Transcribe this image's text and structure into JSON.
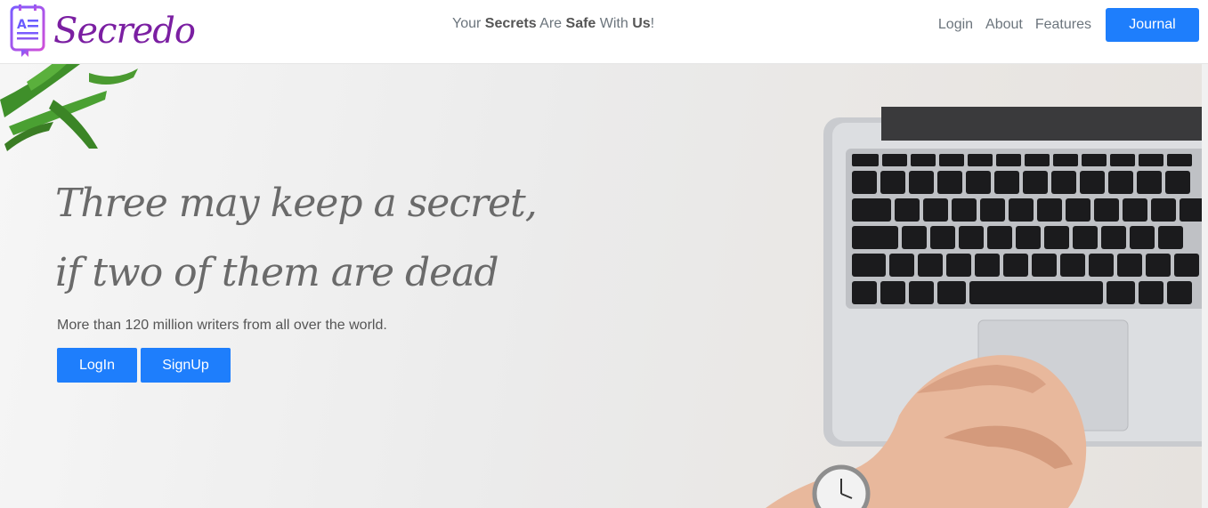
{
  "header": {
    "brand": "Secredo",
    "tagline": {
      "p1": "Your ",
      "b1": "Secrets",
      "p2": " Are ",
      "b2": "Safe",
      "p3": " With ",
      "b3": "Us",
      "p4": "!"
    },
    "nav": {
      "login": "Login",
      "about": "About",
      "features": "Features",
      "journal": "Journal"
    }
  },
  "hero": {
    "quote_line1": "Three may keep a secret,",
    "quote_line2": "if two of them are dead",
    "subtitle": "More than 120 million writers from all over the world.",
    "login_button": "LogIn",
    "signup_button": "SignUp"
  },
  "colors": {
    "accent": "#1e7efc",
    "brand": "#7b1fa2"
  },
  "icons": {
    "logo": "journal-logo-icon"
  }
}
